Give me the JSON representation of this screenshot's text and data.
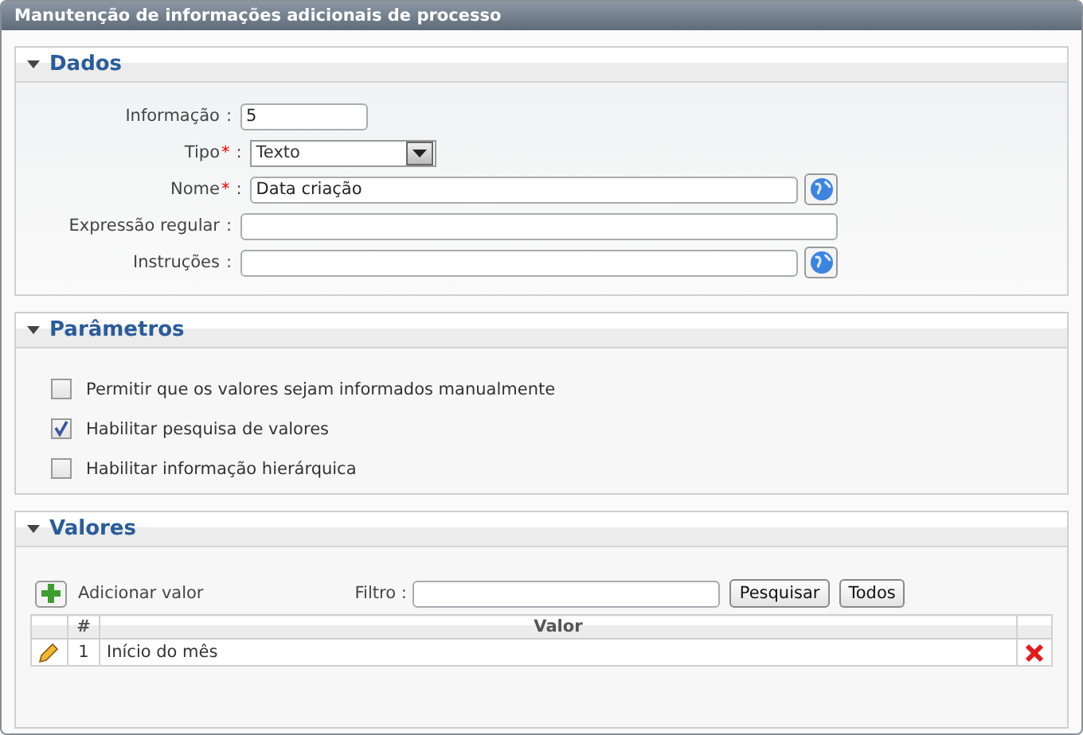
{
  "window": {
    "title": "Manutenção de informações adicionais de processo"
  },
  "dados": {
    "title": "Dados",
    "expanded": true,
    "fields": [
      {
        "label": "Informação",
        "kind": "input",
        "separator": ":",
        "value": "5",
        "lookup": false
      },
      {
        "label": "Tipo",
        "kind": "select",
        "required_mark": "*",
        "separator": ":",
        "value": "Texto",
        "lookup": false
      },
      {
        "label": "Nome",
        "kind": "input",
        "required_mark": "*",
        "separator": ":",
        "value": "Data criação",
        "lookup": true
      },
      {
        "label": "Expressão regular",
        "kind": "input",
        "separator": ":",
        "lookup": false
      },
      {
        "label": "Instruções",
        "kind": "input",
        "separator": ":",
        "lookup": true
      }
    ]
  },
  "parametros": {
    "title": "Parâmetros",
    "expanded": true,
    "options": [
      {
        "label": "Permitir que os valores sejam informados manualmente",
        "checked": false
      },
      {
        "label": "Habilitar pesquisa de valores",
        "checked": true
      },
      {
        "label": "Habilitar informação hierárquica",
        "checked": false
      }
    ]
  },
  "valores": {
    "title": "Valores",
    "expanded": true,
    "add_label": "Adicionar valor",
    "filter_label": "Filtro :",
    "buttons": [
      "Pesquisar",
      "Todos"
    ],
    "table": {
      "columns": [
        "#",
        "Valor"
      ],
      "rows": [
        {
          "number": "1",
          "value": "Início do mês"
        }
      ]
    }
  }
}
